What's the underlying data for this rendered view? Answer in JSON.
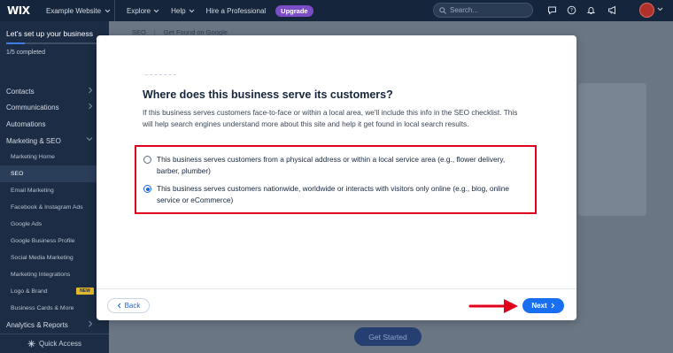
{
  "topbar": {
    "logo": "WIX",
    "site_name": "Example Website",
    "menu": [
      "Explore",
      "Help",
      "Hire a Professional"
    ],
    "upgrade_label": "Upgrade",
    "search_placeholder": "Search..."
  },
  "sidebar": {
    "setup_title": "Let's set up your business",
    "setup_progress_fraction": 0.2,
    "setup_count": "1/5 completed",
    "nav": {
      "contacts": "Contacts",
      "communications": "Communications",
      "automations": "Automations",
      "marketing_seo": "Marketing & SEO",
      "analytics": "Analytics & Reports"
    },
    "sub_items": [
      "Marketing Home",
      "SEO",
      "Email Marketing",
      "Facebook & Instagram Ads",
      "Google Ads",
      "Google Business Profile",
      "Social Media Marketing",
      "Marketing Integrations",
      "Logo & Brand",
      "Business Cards & More"
    ],
    "new_badge": "NEW",
    "quick_access": "Quick Access"
  },
  "main": {
    "breadcrumb": [
      "SEO",
      "Get Found on Google"
    ],
    "get_started": "Get Started"
  },
  "modal": {
    "title": "Where does this business serve its customers?",
    "description": "If this business serves customers face-to-face or within a local area, we'll include this info in the SEO checklist. This will help search engines understand more about this site and help it get found in local search results.",
    "options": [
      {
        "label": "This business serves customers from a physical address or within a local service area (e.g., flower delivery, barber, plumber)",
        "selected": false
      },
      {
        "label": "This business serves customers nationwide, worldwide or interacts with visitors only online (e.g., blog, online service or eCommerce)",
        "selected": true
      }
    ],
    "back_label": "Back",
    "next_label": "Next"
  },
  "colors": {
    "accent": "#1a6ef0",
    "highlight": "#e0001b",
    "topbar": "#15253b",
    "sidebar": "#1b2c44",
    "upgrade": "#7c4dc8"
  }
}
